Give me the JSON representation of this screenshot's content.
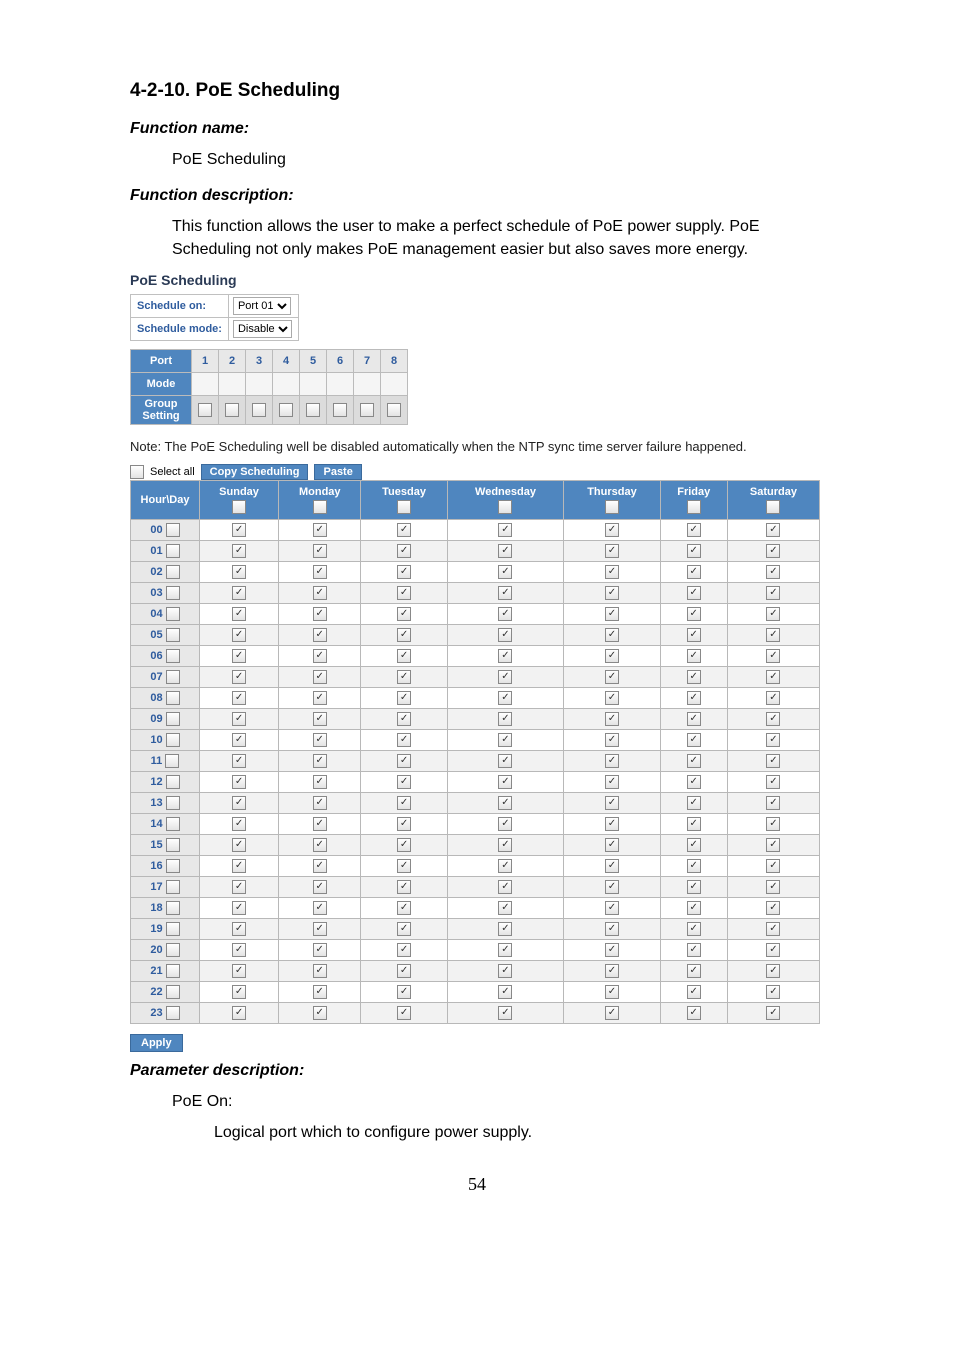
{
  "heading": "4-2-10. PoE Scheduling",
  "function_name_label": "Function name:",
  "function_name_value": "PoE Scheduling",
  "function_desc_label": "Function description:",
  "function_desc_value": "This function allows the user to make a perfect schedule of PoE power supply. PoE Scheduling not only makes PoE management easier but also saves more energy.",
  "panel_title": "PoE Scheduling",
  "meta": {
    "schedule_on_label": "Schedule on:",
    "schedule_on_value": "Port 01",
    "schedule_mode_label": "Schedule mode:",
    "schedule_mode_value": "Disable"
  },
  "port_table": {
    "port_label": "Port",
    "mode_label": "Mode",
    "group_label": "Group Setting",
    "ports": [
      "1",
      "2",
      "3",
      "4",
      "5",
      "6",
      "7",
      "8"
    ]
  },
  "note": "Note: The PoE Scheduling well be disabled automatically when the NTP sync time server failure happened.",
  "toolbar": {
    "select_all_label": "Select all",
    "copy_label": "Copy Scheduling",
    "paste_label": "Paste"
  },
  "grid": {
    "corner_label": "Hour\\Day",
    "days": [
      "Sunday",
      "Monday",
      "Tuesday",
      "Wednesday",
      "Thursday",
      "Friday",
      "Saturday"
    ],
    "hours": [
      "00",
      "01",
      "02",
      "03",
      "04",
      "05",
      "06",
      "07",
      "08",
      "09",
      "10",
      "11",
      "12",
      "13",
      "14",
      "15",
      "16",
      "17",
      "18",
      "19",
      "20",
      "21",
      "22",
      "23"
    ],
    "hour_checked": false,
    "day_header_checked": false,
    "cell_checked": true
  },
  "apply_label": "Apply",
  "param_label": "Parameter description:",
  "param_item_label": "PoE On:",
  "param_item_desc": "Logical port which to configure power supply.",
  "page_number": "54"
}
